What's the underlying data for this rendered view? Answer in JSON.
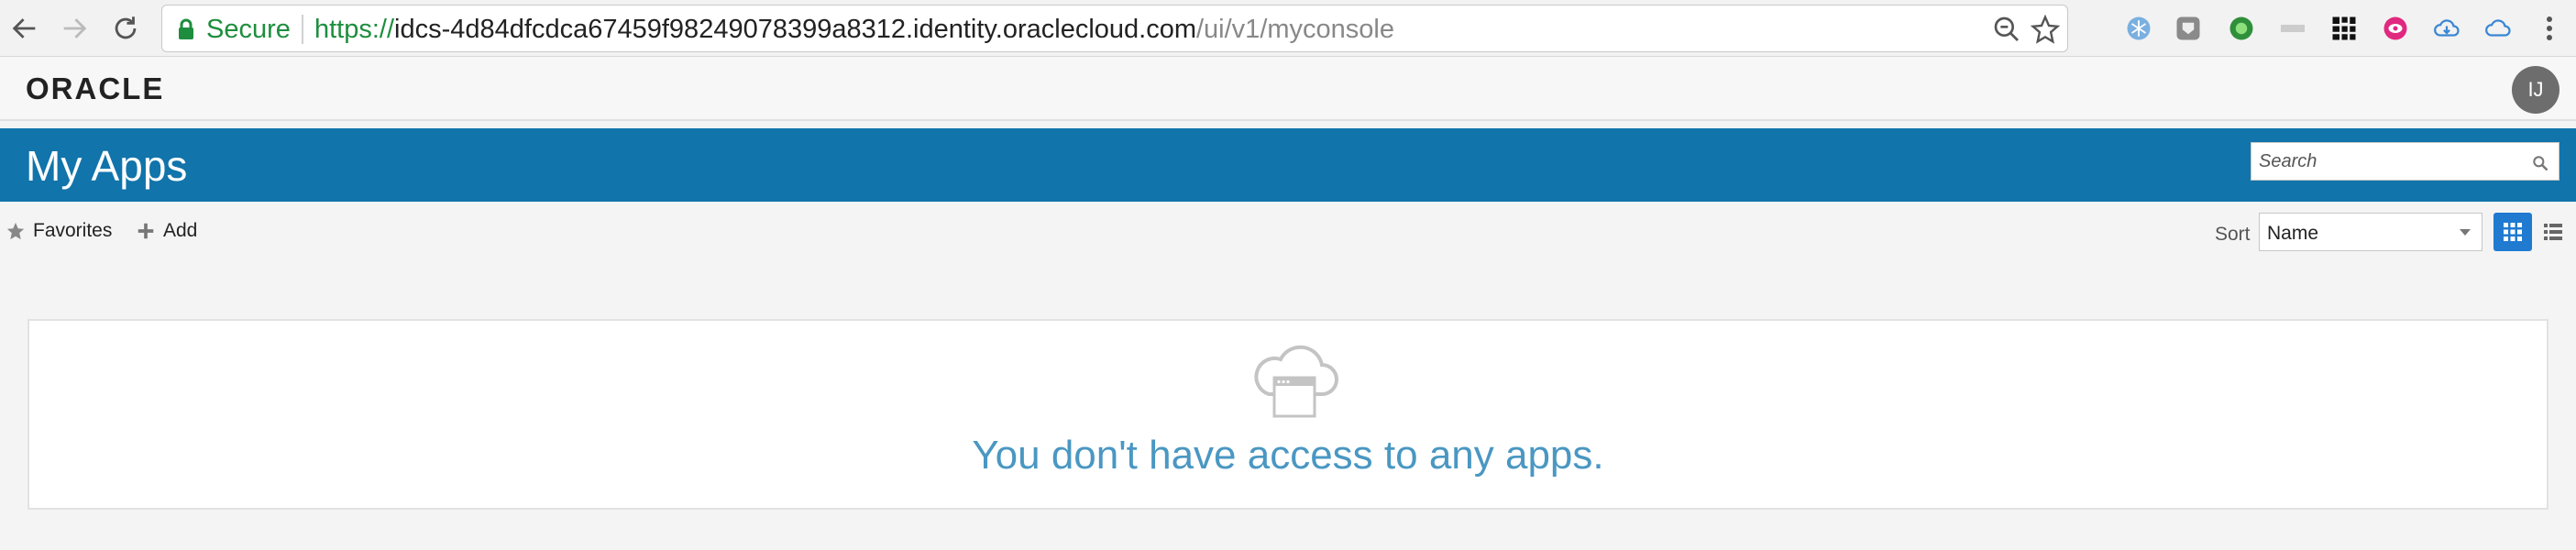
{
  "browser": {
    "secure_label": "Secure",
    "url_scheme": "https://",
    "url_host": "idcs-4d84dfcdca67459f98249078399a8312.identity.oraclecloud.com",
    "url_path": "/ui/v1/myconsole"
  },
  "header": {
    "logo_text": "ORACLE",
    "avatar_initials": "IJ"
  },
  "title_band": {
    "title": "My Apps",
    "search_placeholder": "Search"
  },
  "toolbar": {
    "favorites_label": "Favorites",
    "add_label": "Add",
    "sort_label": "Sort",
    "sort_value": "Name"
  },
  "empty_state": {
    "message": "You don't have access to any apps."
  },
  "colors": {
    "brand_blue": "#1174ab",
    "empty_text": "#4a97c2",
    "secure_green": "#1e8e3e"
  }
}
